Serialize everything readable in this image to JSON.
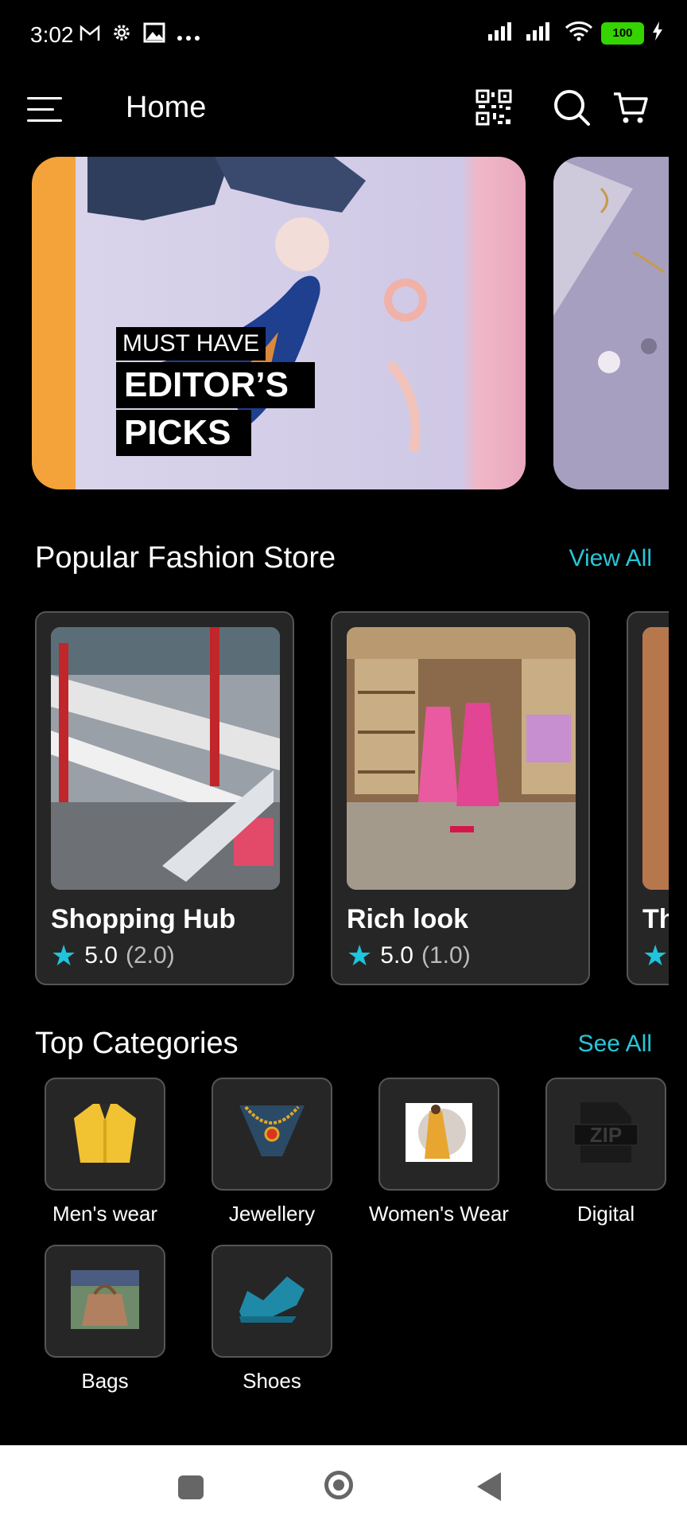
{
  "status": {
    "time": "3:02",
    "battery": "100",
    "icons_left": [
      "gmail-icon",
      "settings-icon",
      "photo-icon",
      "more-icon"
    ],
    "icons_right": [
      "signal-icon",
      "signal-icon",
      "wifi-icon",
      "battery-icon",
      "charging-icon"
    ]
  },
  "appbar": {
    "title": "Home",
    "icons": [
      "menu-icon",
      "qr-code-icon",
      "search-icon",
      "cart-icon"
    ]
  },
  "banners": [
    {
      "line1": "MUST HAVE",
      "line2": "EDITOR’S",
      "line3": "PICKS"
    }
  ],
  "popular": {
    "title": "Popular Fashion Store",
    "link": "View All",
    "stores": [
      {
        "name": "Shopping Hub",
        "rating": "5.0",
        "count": "(2.0)"
      },
      {
        "name": "Rich look",
        "rating": "5.0",
        "count": "(1.0)"
      },
      {
        "name": "Th"
      }
    ]
  },
  "categories": {
    "title": "Top Categories",
    "link": "See All",
    "items": [
      {
        "label": "Men's wear",
        "icon": "mens-wear-icon"
      },
      {
        "label": "Jewellery",
        "icon": "jewellery-icon"
      },
      {
        "label": "Women's Wear",
        "icon": "womens-wear-icon"
      },
      {
        "label": "Digital",
        "icon": "zip-file-icon"
      },
      {
        "label": "Bags",
        "icon": "bag-icon"
      },
      {
        "label": "Shoes",
        "icon": "shoe-icon"
      }
    ]
  },
  "colors": {
    "accent": "#28c6d8",
    "card": "#262626",
    "background": "#000000"
  }
}
